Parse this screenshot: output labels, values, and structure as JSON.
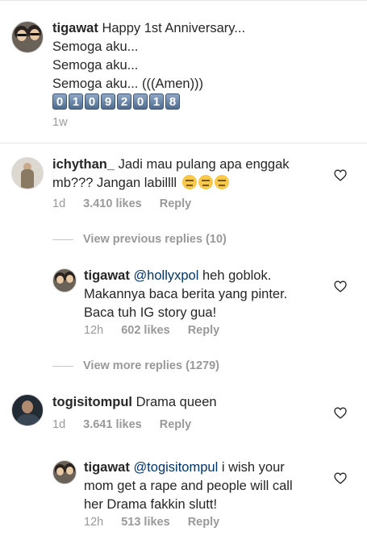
{
  "caption": {
    "username": "tigawat",
    "lines": [
      "Happy 1st Anniversary...",
      "Semoga aku...",
      "Semoga aku...",
      "Semoga aku... (((Amen)))"
    ],
    "date_digits": [
      "0",
      "1",
      "0",
      "9",
      "2",
      "0",
      "1",
      "8"
    ],
    "time": "1w"
  },
  "comments": [
    {
      "username": "ichythan_",
      "line1": "Jadi mau pulang apa enggak",
      "line2": "mb??? Jangan labillll",
      "time": "1d",
      "likes": "3.410 likes",
      "reply": "Reply"
    },
    {
      "username": "tigawat",
      "mention": "@hollyxpol",
      "line1_rest": "heh goblok.",
      "line2": "Makannya baca berita yang pinter.",
      "line3": "Baca tuh IG story gua!",
      "time": "12h",
      "likes": "602 likes",
      "reply": "Reply"
    },
    {
      "username": "togisitompul",
      "line1": "Drama queen",
      "time": "1d",
      "likes": "3.641 likes",
      "reply": "Reply"
    },
    {
      "username": "tigawat",
      "mention": "@togisitompul",
      "line1_rest": "i wish your",
      "line2": "mom get a rape and people will call",
      "line3": "her Drama fakkin slutt!",
      "time": "12h",
      "likes": "513 likes",
      "reply": "Reply"
    }
  ],
  "view_previous": "View previous replies (10)",
  "view_more": "View more replies (1279)"
}
